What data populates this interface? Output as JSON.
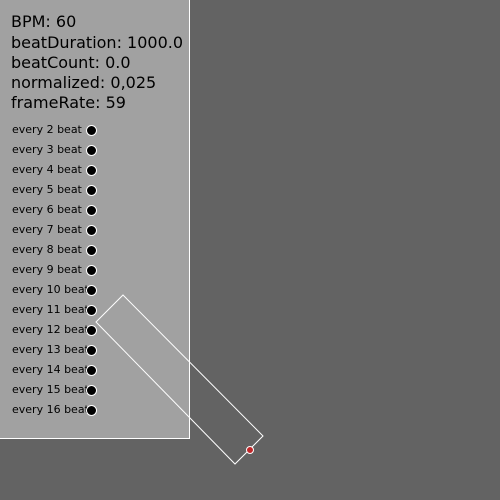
{
  "stats": {
    "bpm": "BPM: 60",
    "beat_duration": "beatDuration: 1000.0",
    "beat_count": "beatCount: 0.0",
    "normalized": "normalized: 0,025",
    "frame_rate": "frameRate: 59"
  },
  "beat_rows": [
    {
      "label": "every 2 beat"
    },
    {
      "label": "every 3 beat"
    },
    {
      "label": "every 4 beat"
    },
    {
      "label": "every 5 beat"
    },
    {
      "label": "every 6 beat"
    },
    {
      "label": "every 7 beat"
    },
    {
      "label": "every 8 beat"
    },
    {
      "label": "every 9 beat"
    },
    {
      "label": "every 10 beat"
    },
    {
      "label": "every 11 beat"
    },
    {
      "label": "every 12 beat"
    },
    {
      "label": "every 13 beat"
    },
    {
      "label": "every 14 beat"
    },
    {
      "label": "every 15 beat"
    },
    {
      "label": "every 16 beat"
    }
  ],
  "colors": {
    "background": "#636363",
    "panel": "#a1a1a1",
    "indicator_off": "#000000",
    "outline": "#ffffff",
    "pendulum_marker": "#c0282a"
  }
}
